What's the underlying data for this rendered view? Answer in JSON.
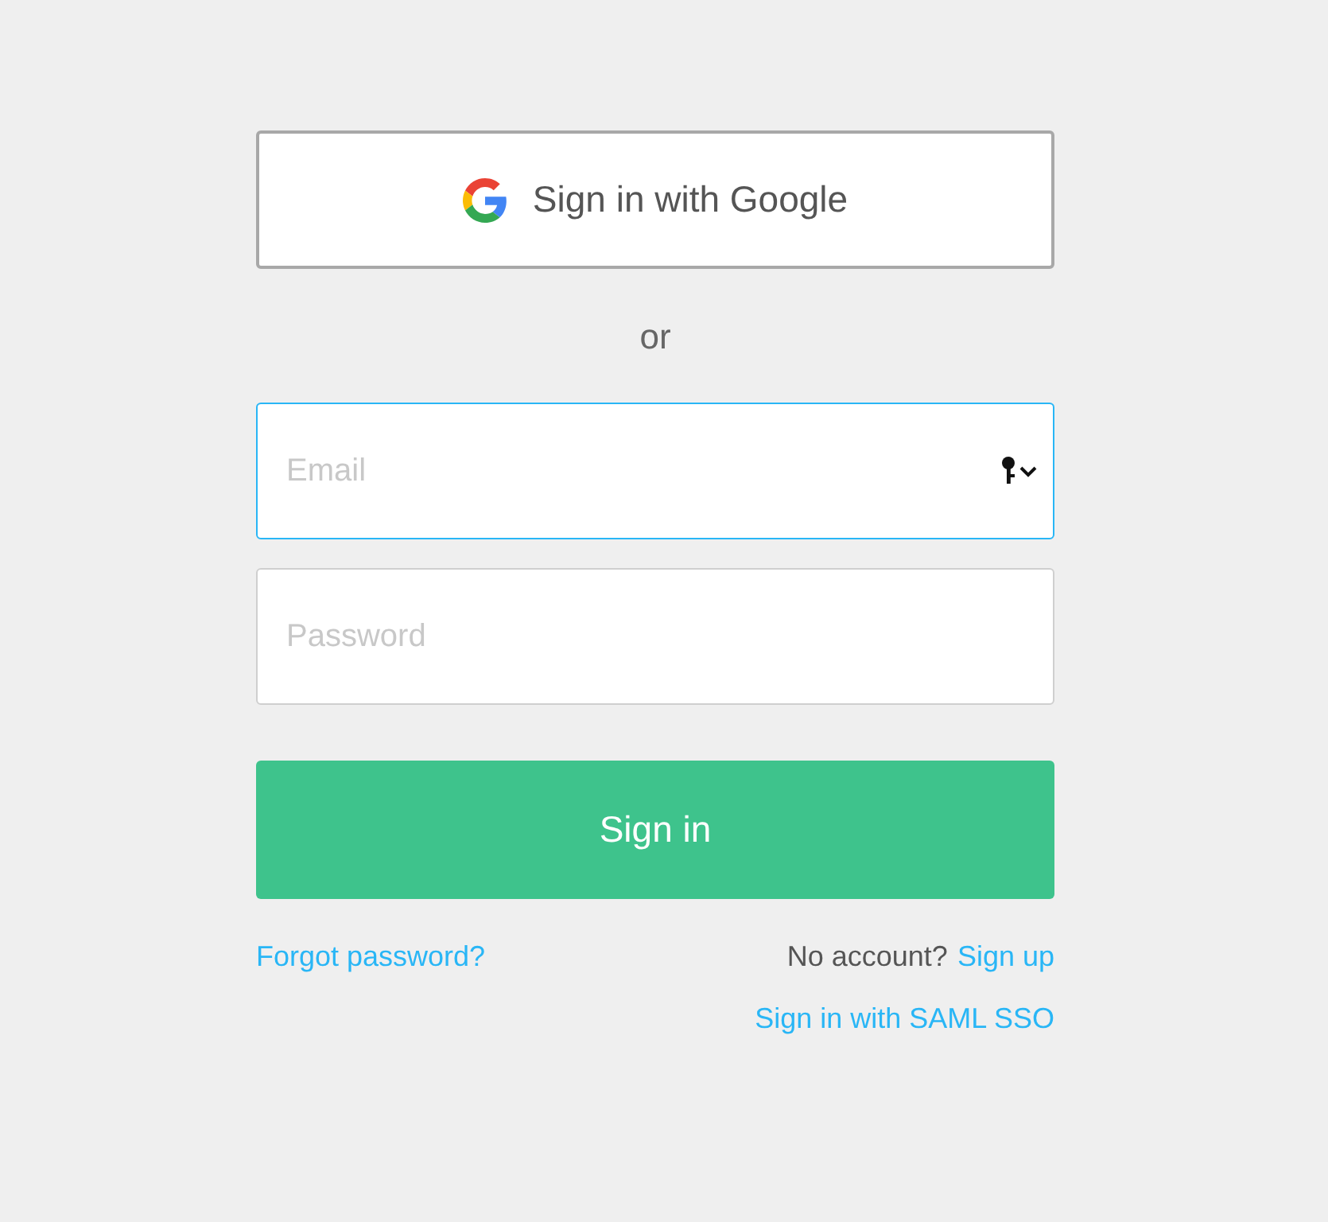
{
  "google_button": {
    "label": "Sign in with Google"
  },
  "separator": "or",
  "email": {
    "placeholder": "Email",
    "focused": true
  },
  "password": {
    "placeholder": "Password",
    "focused": false
  },
  "submit_button": {
    "label": "Sign in"
  },
  "forgot_link": "Forgot password?",
  "signup_prompt": "No account?",
  "signup_link": "Sign up",
  "saml_link": "Sign in with SAML SSO"
}
